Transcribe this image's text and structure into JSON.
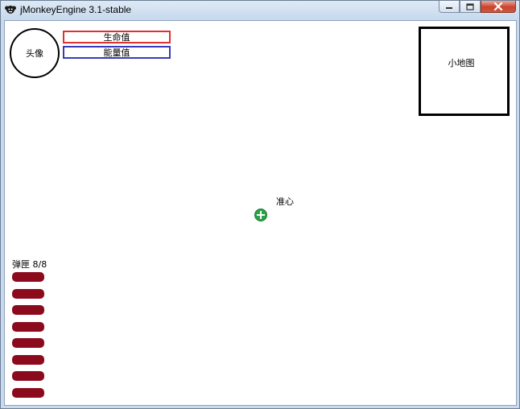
{
  "window": {
    "title": "jMonkeyEngine 3.1-stable",
    "minimize_icon": "minimize-icon",
    "maximize_icon": "maximize-icon",
    "close_icon": "close-icon",
    "app_icon": "jmonkey-logo-icon"
  },
  "hud": {
    "avatar_label": "头像",
    "health_label": "生命值",
    "energy_label": "能量值",
    "minimap_label": "小地图",
    "crosshair_label": "准心",
    "ammo_label": "弹匣 8/8",
    "ammo_current": 8,
    "ammo_max": 8,
    "colors": {
      "health_border": "#e03030",
      "energy_border": "#3a3ab8",
      "bullet": "#8b0a1c",
      "crosshair": "#2aa24a"
    }
  }
}
